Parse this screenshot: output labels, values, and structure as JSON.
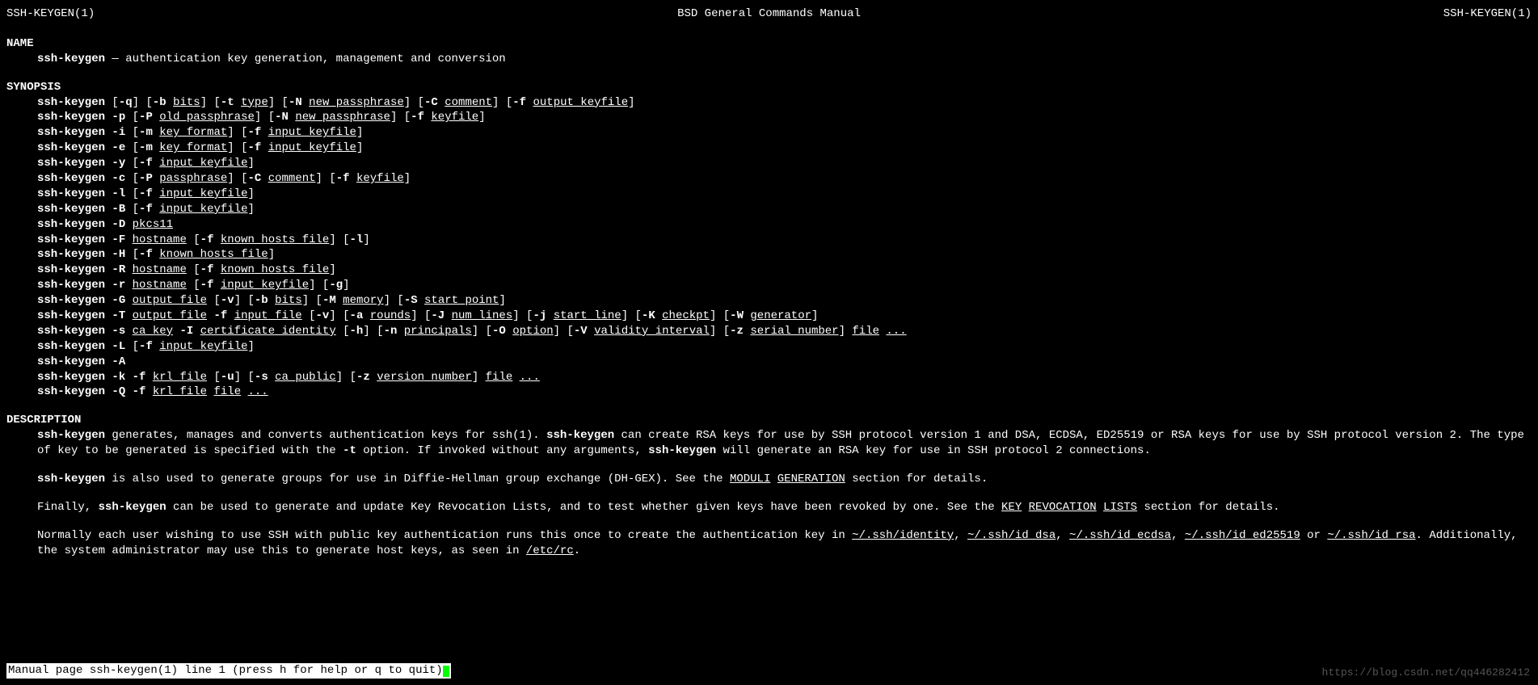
{
  "header": {
    "left": "SSH-KEYGEN(1)",
    "center": "BSD General Commands Manual",
    "right": "SSH-KEYGEN(1)"
  },
  "sections": {
    "name": {
      "title": "NAME",
      "cmd": "ssh-keygen",
      "desc": " — authentication key generation, management and conversion"
    },
    "synopsis": {
      "title": "SYNOPSIS"
    },
    "description": {
      "title": "DESCRIPTION"
    }
  },
  "syn": {
    "cmd": "ssh-keygen",
    "l1": {
      "q": "-q",
      "b": "-b",
      "bits": "bits",
      "t": "-t",
      "type": "type",
      "N": "-N",
      "np": "new_passphrase",
      "C": "-C",
      "com": "comment",
      "f": "-f",
      "ok": "output_keyfile"
    },
    "l2": {
      "p": "-p",
      "P": "-P",
      "op": "old_passphrase",
      "N": "-N",
      "np": "new_passphrase",
      "f": "-f",
      "kf": "keyfile"
    },
    "l3": {
      "i": "-i",
      "m": "-m",
      "kfmt": "key_format",
      "f": "-f",
      "ik": "input_keyfile"
    },
    "l4": {
      "e": "-e",
      "m": "-m",
      "kfmt": "key_format",
      "f": "-f",
      "ik": "input_keyfile"
    },
    "l5": {
      "y": "-y",
      "f": "-f",
      "ik": "input_keyfile"
    },
    "l6": {
      "c": "-c",
      "P": "-P",
      "pp": "passphrase",
      "C": "-C",
      "com": "comment",
      "f": "-f",
      "kf": "keyfile"
    },
    "l7": {
      "l": "-l",
      "f": "-f",
      "ik": "input_keyfile"
    },
    "l8": {
      "B": "-B",
      "f": "-f",
      "ik": "input_keyfile"
    },
    "l9": {
      "D": "-D",
      "pk": "pkcs11"
    },
    "l10": {
      "F": "-F",
      "hn": "hostname",
      "f": "-f",
      "kh": "known_hosts_file",
      "l": "-l"
    },
    "l11": {
      "H": "-H",
      "f": "-f",
      "kh": "known_hosts_file"
    },
    "l12": {
      "R": "-R",
      "hn": "hostname",
      "f": "-f",
      "kh": "known_hosts_file"
    },
    "l13": {
      "r": "-r",
      "hn": "hostname",
      "f": "-f",
      "ik": "input_keyfile",
      "g": "-g"
    },
    "l14": {
      "G": "-G",
      "of": "output_file",
      "v": "-v",
      "b": "-b",
      "bits": "bits",
      "M": "-M",
      "mem": "memory",
      "S": "-S",
      "sp": "start_point"
    },
    "l15": {
      "T": "-T",
      "of": "output_file",
      "f": "-f",
      "if": "input_file",
      "v": "-v",
      "a": "-a",
      "rounds": "rounds",
      "J": "-J",
      "nl": "num_lines",
      "j": "-j",
      "sl": "start_line",
      "K": "-K",
      "ck": "checkpt",
      "W": "-W",
      "gen": "generator"
    },
    "l16": {
      "s": "-s",
      "ca": "ca_key",
      "I": "-I",
      "ci": "certificate_identity",
      "h": "-h",
      "n": "-n",
      "pr": "principals",
      "O": "-O",
      "opt": "option",
      "V": "-V",
      "vi": "validity_interval",
      "z": "-z",
      "sn": "serial_number",
      "file": "file",
      "dots": "..."
    },
    "l17": {
      "L": "-L",
      "f": "-f",
      "ik": "input_keyfile"
    },
    "l18": {
      "A": "-A"
    },
    "l19": {
      "k": "-k",
      "f": "-f",
      "krl": "krl_file",
      "u": "-u",
      "s": "-s",
      "cap": "ca_public",
      "z": "-z",
      "vn": "version_number",
      "file": "file",
      "dots": "..."
    },
    "l20": {
      "Q": "-Q",
      "f": "-f",
      "krl": "krl_file",
      "file": "file",
      "dots": "..."
    }
  },
  "desc": {
    "p1a": "ssh-keygen",
    "p1b": " generates, manages and converts authentication keys for ssh(1).  ",
    "p1c": "ssh-keygen",
    "p1d": " can create RSA keys for use by SSH protocol version 1 and DSA, ECDSA, ED25519 or RSA keys for use by SSH protocol version 2.  The type of key to be generated is specified with the ",
    "p1e": "-t",
    "p1f": " option.  If invoked without any arguments, ",
    "p1g": "ssh-keygen",
    "p1h": " will generate an RSA key for use in SSH protocol 2 connections.",
    "p2a": "ssh-keygen",
    "p2b": " is also used to generate groups for use in Diffie-Hellman group exchange (DH-GEX).  See the ",
    "p2c": "MODULI",
    "p2d": "GENERATION",
    "p2e": " section for details.",
    "p3a": "Finally, ",
    "p3b": "ssh-keygen",
    "p3c": " can be used to generate and update Key Revocation Lists, and to test whether given keys have been revoked by one.  See the ",
    "p3d": "KEY",
    "p3e": "REVOCATION",
    "p3f": "LISTS",
    "p3g": " section for details.",
    "p4a": "Normally each user wishing to use SSH with public key authentication runs this once to create the authentication key in ",
    "p4b": "~/.ssh/identity",
    "p4c": "~/.ssh/id_dsa",
    "p4d": "~/.ssh/id_ecdsa",
    "p4e": "~/.ssh/id_ed25519",
    "p4or": " or ",
    "p4f": "~/.ssh/id_rsa",
    "p4g": ".  Additionally, the system administrator may use this to generate host keys, as seen in ",
    "p4h": "/etc/rc",
    "p4i": "."
  },
  "status": " Manual page ssh-keygen(1) line 1 (press h for help or q to quit)",
  "watermark": "https://blog.csdn.net/qq446282412"
}
